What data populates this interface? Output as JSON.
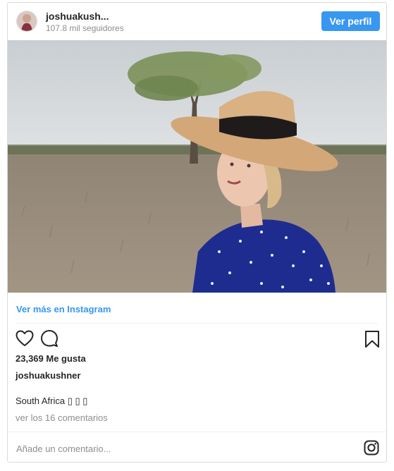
{
  "header": {
    "username": "joshuakush...",
    "followers": "107.8 mil seguidores",
    "view_profile_label": "Ver perfil",
    "avatar_icon": "profile-avatar"
  },
  "post": {
    "view_more_label": "Ver más en Instagram",
    "likes": "23,369 Me gusta",
    "owner": "joshuakushner",
    "caption": "South Africa ▯ ▯ ▯",
    "comments_link": "ver los 16 comentarios",
    "comment_placeholder": "Añade un comentario...",
    "icons": [
      "heart-icon",
      "comment-icon",
      "bookmark-icon",
      "instagram-logo-icon"
    ]
  },
  "colors": {
    "accent": "#3897f0",
    "muted": "#8e8e8e",
    "text": "#262626",
    "border": "#dbdbdb"
  }
}
